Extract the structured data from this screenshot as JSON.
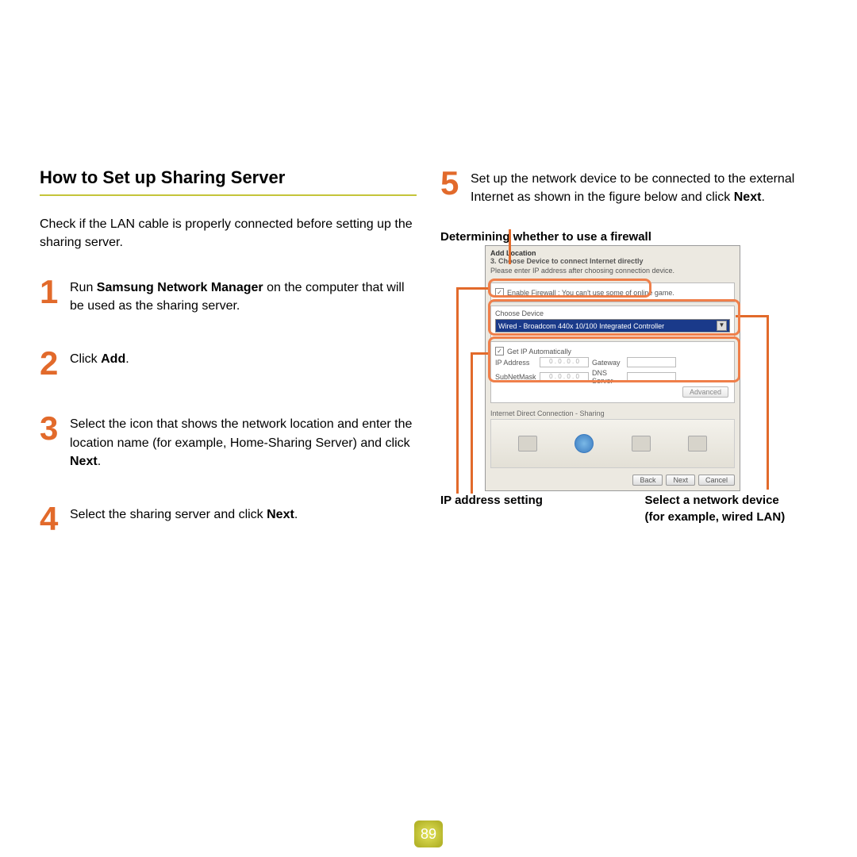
{
  "left": {
    "title": "How to Set up Sharing Server",
    "intro": "Check if the LAN cable is properly connected before setting up the sharing server.",
    "steps": {
      "s1": {
        "num": "1",
        "pre": "Run ",
        "bold": "Samsung Network Manager",
        "post": " on the computer that will be used as the sharing server."
      },
      "s2": {
        "num": "2",
        "pre": "Click ",
        "bold": "Add",
        "post": "."
      },
      "s3": {
        "num": "3",
        "text": "Select the icon that shows the network location and enter the location name (for example, Home-Sharing Server) and click ",
        "bold": "Next",
        "post": "."
      },
      "s4": {
        "num": "4",
        "text": "Select the sharing server and click ",
        "bold": "Next",
        "post": "."
      }
    }
  },
  "right": {
    "step5": {
      "num": "5",
      "text": "Set up the network device to be connected to the external Internet as shown in the figure below and click ",
      "bold": "Next",
      "post": "."
    },
    "callout_top": "Determining whether to use a firewall",
    "callout_ip": "IP address setting",
    "callout_device_l1": "Select a network device",
    "callout_device_l2": "(for example, wired LAN)"
  },
  "dialog": {
    "title": "Add Location",
    "sub": "3. Choose Device to connect Internet directly",
    "desc": "Please enter IP address after choosing connection device.",
    "firewall_cb_checked": "✓",
    "firewall_label": "Enable Firewall : You can't use some of online game.",
    "choose_device_label": "Choose Device",
    "device_selected": "Wired - Broadcom 440x 10/100 Integrated Controller",
    "getip_cb_checked": "✓",
    "getip": "Get IP Automatically",
    "ipaddr": "IP Address",
    "subnet": "SubNetMask",
    "gateway": "Gateway",
    "dns": "DNS Server",
    "adv_btn": "Advanced",
    "section": "Internet Direct Connection - Sharing",
    "btn_back": "Back",
    "btn_next": "Next",
    "btn_cancel": "Cancel",
    "ip_placeholder": "0 . 0 . 0 . 0"
  },
  "page_number": "89"
}
